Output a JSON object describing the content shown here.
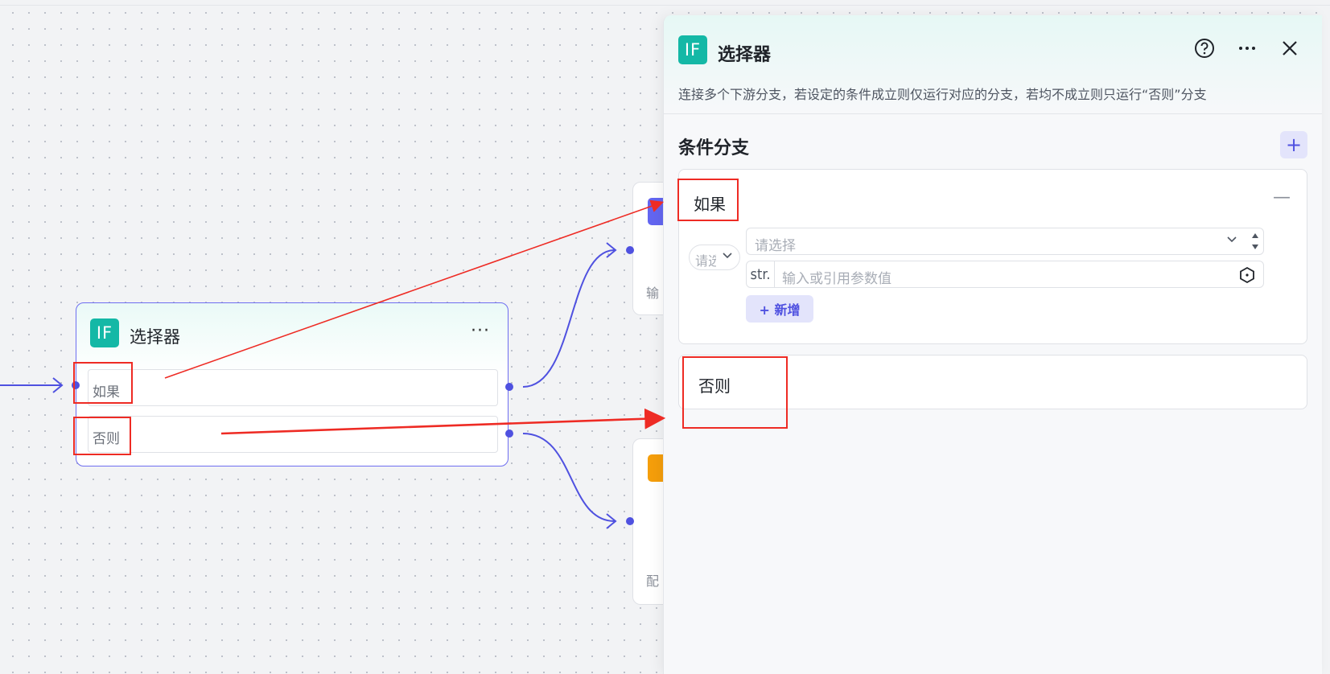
{
  "canvas": {
    "node": {
      "icon": "IF",
      "title": "选择器",
      "more_label": "···",
      "branches": [
        {
          "label": "如果"
        },
        {
          "label": "否则"
        }
      ]
    },
    "peek_nodes": [
      {
        "text": "输"
      },
      {
        "text": "配"
      }
    ]
  },
  "panel": {
    "icon": "IF",
    "title": "选择器",
    "help_icon": "help-circle-icon",
    "more_icon": "more-icon",
    "close_icon": "close-icon",
    "description": "连接多个下游分支，若设定的条件成立则仅运行对应的分支，若均不成立则只运行“否则”分支",
    "section_title": "条件分支",
    "add_branch_label": "+",
    "condition": {
      "label": "如果",
      "collapse_label": "—",
      "logic_placeholder": "请选",
      "variable_placeholder": "请选择",
      "type_tag": "str.",
      "value_placeholder": "输入或引用参数值",
      "add_label": "+ 新增"
    },
    "else_label": "否则"
  },
  "colors": {
    "accent": "#4f51e0",
    "if_icon": "#14b8a6",
    "annotation": "#ee2b24"
  }
}
